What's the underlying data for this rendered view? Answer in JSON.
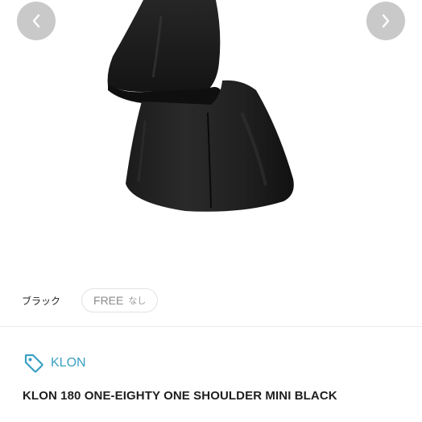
{
  "gallery": {
    "image_alt": "black leather shoulder bag",
    "prev_icon": "chevron-left-icon",
    "next_icon": "chevron-right-icon"
  },
  "variant": {
    "color": "ブラック",
    "size": "FREE",
    "status": "なし"
  },
  "brand": {
    "icon": "tag-icon",
    "name": "KLON",
    "color": "#3aa0c2"
  },
  "product": {
    "title": "KLON 180 ONE-EIGHTY ONE SHOULDER MINI BLACK"
  }
}
